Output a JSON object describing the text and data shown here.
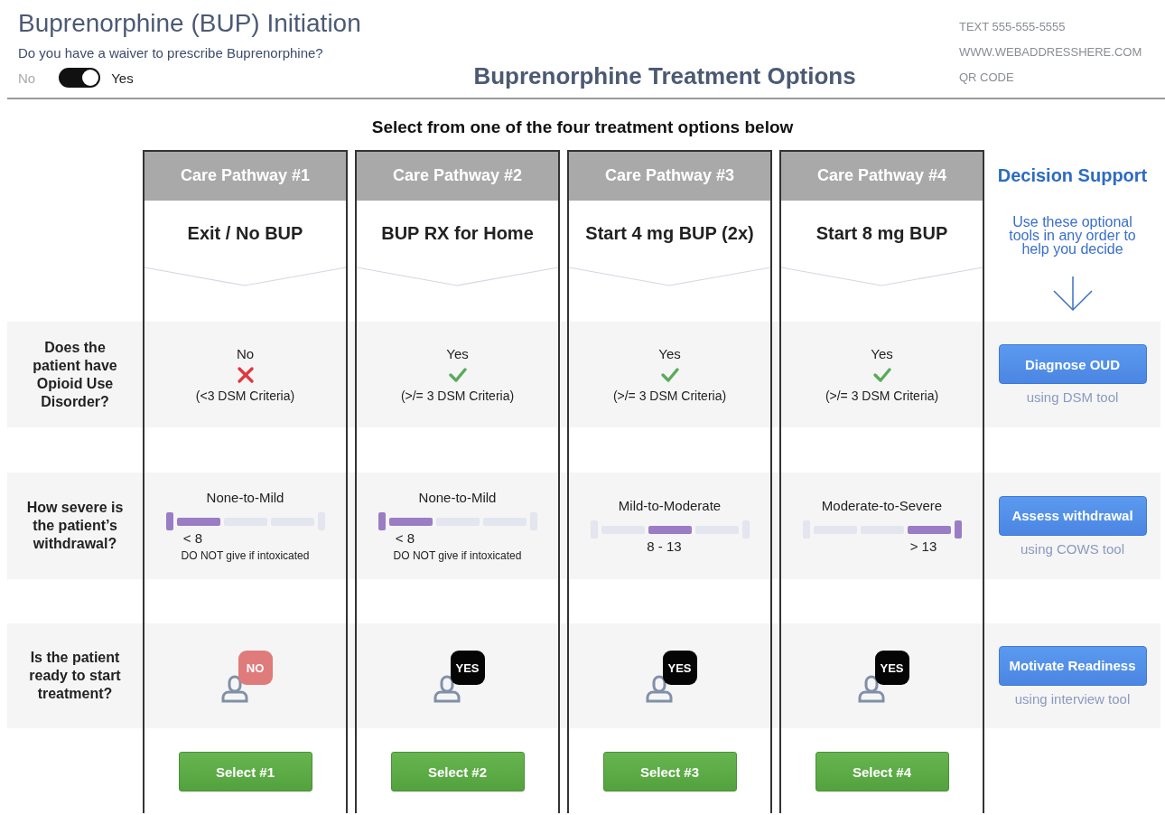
{
  "header": {
    "title": "Buprenorphine (BUP) Initiation",
    "question": "Do you have a waiver to prescribe Buprenorphine?",
    "toggle": {
      "off_label": "No",
      "on_label": "Yes",
      "on": true
    },
    "contact": [
      "TEXT 555-555-5555",
      "WWW.WEBADDRESSHERE.COM",
      "QR CODE"
    ]
  },
  "title": "Buprenorphine Treatment Options",
  "instruction": "Select from one of the four treatment options below",
  "questions": [
    "Does the patient have Opioid Use Disorder?",
    "How severe is the patient’s withdrawal?",
    "Is the patient ready to start treatment?"
  ],
  "pathways": [
    {
      "header": "Care Pathway #1",
      "title": "Exit / No BUP",
      "diagnosis": {
        "answer": "No",
        "met": false,
        "criteria": "(<3 DSM Criteria)"
      },
      "withdrawal": {
        "label": "None-to-Mild",
        "segments": [
          {
            "on": true
          },
          {
            "on": false
          },
          {
            "on": false
          }
        ],
        "range": "< 8",
        "note": "DO NOT give if intoxicated"
      },
      "ready": {
        "badge": "NO",
        "ready": false
      },
      "select": "Select #1"
    },
    {
      "header": "Care Pathway #2",
      "title": "BUP RX for Home",
      "diagnosis": {
        "answer": "Yes",
        "met": true,
        "criteria": "(>/= 3 DSM Criteria)"
      },
      "withdrawal": {
        "label": "None-to-Mild",
        "segments": [
          {
            "on": true
          },
          {
            "on": false
          },
          {
            "on": false
          }
        ],
        "range": "< 8",
        "note": "DO NOT give if intoxicated"
      },
      "ready": {
        "badge": "YES",
        "ready": true
      },
      "select": "Select #2"
    },
    {
      "header": "Care Pathway #3",
      "title": "Start 4 mg BUP (2x)",
      "diagnosis": {
        "answer": "Yes",
        "met": true,
        "criteria": "(>/= 3 DSM Criteria)"
      },
      "withdrawal": {
        "label": "Mild-to-Moderate",
        "segments": [
          {
            "on": false
          },
          {
            "on": true
          },
          {
            "on": false
          }
        ],
        "range": "8 - 13"
      },
      "ready": {
        "badge": "YES",
        "ready": true
      },
      "select": "Select #3"
    },
    {
      "header": "Care Pathway #4",
      "title": "Start 8 mg BUP",
      "diagnosis": {
        "answer": "Yes",
        "met": true,
        "criteria": "(>/= 3 DSM Criteria)"
      },
      "withdrawal": {
        "label": "Moderate-to-Severe",
        "segments": [
          {
            "on": false
          },
          {
            "on": false
          },
          {
            "on": true
          }
        ],
        "range": "> 13"
      },
      "ready": {
        "badge": "YES",
        "ready": true
      },
      "select": "Select #4"
    }
  ],
  "decision_support": {
    "title": "Decision Support",
    "intro": "Use these optional tools in any order to help you decide",
    "tools": [
      {
        "button": "Diagnose OUD",
        "caption": "using DSM tool"
      },
      {
        "button": "Assess withdrawal",
        "caption": "using COWS tool"
      },
      {
        "button": "Motivate Readiness",
        "caption": "using interview tool"
      }
    ]
  }
}
